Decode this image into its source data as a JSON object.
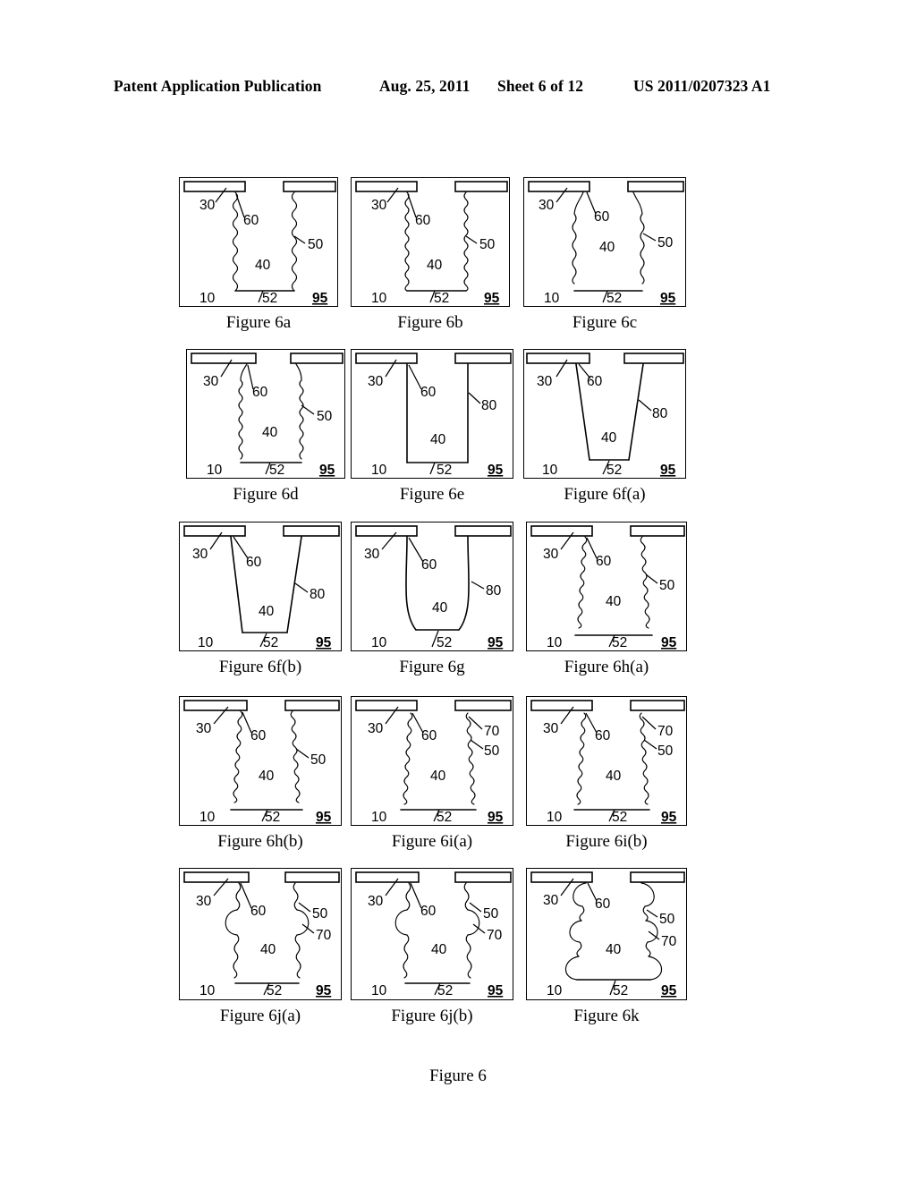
{
  "header": {
    "publication": "Patent Application Publication",
    "date": "Aug. 25, 2011",
    "sheet": "Sheet 6 of 12",
    "number": "US 2011/0207323 A1"
  },
  "figure_title": "Figure 6",
  "reference_numerals": {
    "substrate": "10",
    "mask_layer": "30",
    "trench": "40",
    "sidewall": "50",
    "trench_bottom": "52",
    "mask_edge": "60",
    "smooth_sidewall": "80",
    "notch": "70",
    "device": "95"
  },
  "panels": [
    {
      "id": "6a",
      "caption": "Figure 6a",
      "profile": "straight-scalloped-narrow",
      "labels": [
        "30",
        "60",
        "50",
        "40",
        "10",
        "52",
        "95"
      ]
    },
    {
      "id": "6b",
      "caption": "Figure 6b",
      "profile": "straight-fine-scalloped",
      "labels": [
        "30",
        "60",
        "50",
        "40",
        "10",
        "52",
        "95"
      ]
    },
    {
      "id": "6c",
      "caption": "Figure 6c",
      "profile": "undercut-scalloped-wide",
      "labels": [
        "30",
        "60",
        "50",
        "40",
        "10",
        "52",
        "95"
      ]
    },
    {
      "id": "6d",
      "caption": "Figure 6d",
      "profile": "undercut-scalloped-narrow",
      "labels": [
        "30",
        "60",
        "50",
        "40",
        "10",
        "52",
        "95"
      ]
    },
    {
      "id": "6e",
      "caption": "Figure 6e",
      "profile": "vertical-smooth",
      "labels": [
        "30",
        "60",
        "80",
        "40",
        "10",
        "52",
        "95"
      ]
    },
    {
      "id": "6f(a)",
      "caption": "Figure 6f(a)",
      "profile": "tapered-smooth-steep",
      "labels": [
        "30",
        "60",
        "80",
        "40",
        "10",
        "52",
        "95"
      ]
    },
    {
      "id": "6f(b)",
      "caption": "Figure 6f(b)",
      "profile": "tapered-smooth-shallow",
      "labels": [
        "30",
        "60",
        "80",
        "40",
        "10",
        "52",
        "95"
      ]
    },
    {
      "id": "6g",
      "caption": "Figure 6g",
      "profile": "u-shaped-smooth",
      "labels": [
        "30",
        "60",
        "80",
        "40",
        "10",
        "52",
        "95"
      ]
    },
    {
      "id": "6h(a)",
      "caption": "Figure 6h(a)",
      "profile": "tapered-scalloped",
      "labels": [
        "30",
        "60",
        "50",
        "40",
        "10",
        "52",
        "95"
      ]
    },
    {
      "id": "6h(b)",
      "caption": "Figure 6h(b)",
      "profile": "tapered-scalloped-b",
      "labels": [
        "30",
        "60",
        "50",
        "40",
        "10",
        "52",
        "95"
      ]
    },
    {
      "id": "6i(a)",
      "caption": "Figure 6i(a)",
      "profile": "scalloped-with-notch",
      "labels": [
        "30",
        "60",
        "70",
        "50",
        "40",
        "10",
        "52",
        "95"
      ]
    },
    {
      "id": "6i(b)",
      "caption": "Figure 6i(b)",
      "profile": "scalloped-with-notch-b",
      "labels": [
        "30",
        "60",
        "70",
        "50",
        "40",
        "10",
        "52",
        "95"
      ]
    },
    {
      "id": "6j(a)",
      "caption": "Figure 6j(a)",
      "profile": "single-bulge",
      "labels": [
        "30",
        "60",
        "50",
        "70",
        "40",
        "10",
        "52",
        "95"
      ]
    },
    {
      "id": "6j(b)",
      "caption": "Figure 6j(b)",
      "profile": "single-bulge-b",
      "labels": [
        "30",
        "60",
        "50",
        "70",
        "40",
        "10",
        "52",
        "95"
      ]
    },
    {
      "id": "6k",
      "caption": "Figure 6k",
      "profile": "multi-bulge",
      "labels": [
        "30",
        "60",
        "50",
        "70",
        "40",
        "10",
        "52",
        "95"
      ]
    }
  ]
}
